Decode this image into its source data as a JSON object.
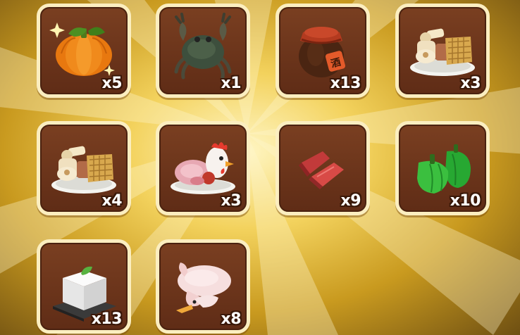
{
  "inventory": {
    "items": [
      {
        "name": "pumpkin",
        "count": "x5"
      },
      {
        "name": "crab",
        "count": "x1"
      },
      {
        "name": "wine-jar",
        "count": "x13"
      },
      {
        "name": "meat-platter",
        "count": "x3"
      },
      {
        "name": "meat-platter",
        "count": "x4"
      },
      {
        "name": "chicken-dish",
        "count": "x3"
      },
      {
        "name": "raw-meat",
        "count": "x9"
      },
      {
        "name": "green-pepper",
        "count": "x10"
      },
      {
        "name": "tofu",
        "count": "x13"
      },
      {
        "name": "duck",
        "count": "x8"
      }
    ],
    "jar_label": "酒"
  },
  "colors": {
    "slot_bg": "#6a3219",
    "slot_border": "#fbeec0",
    "count_text": "#ffffff"
  }
}
